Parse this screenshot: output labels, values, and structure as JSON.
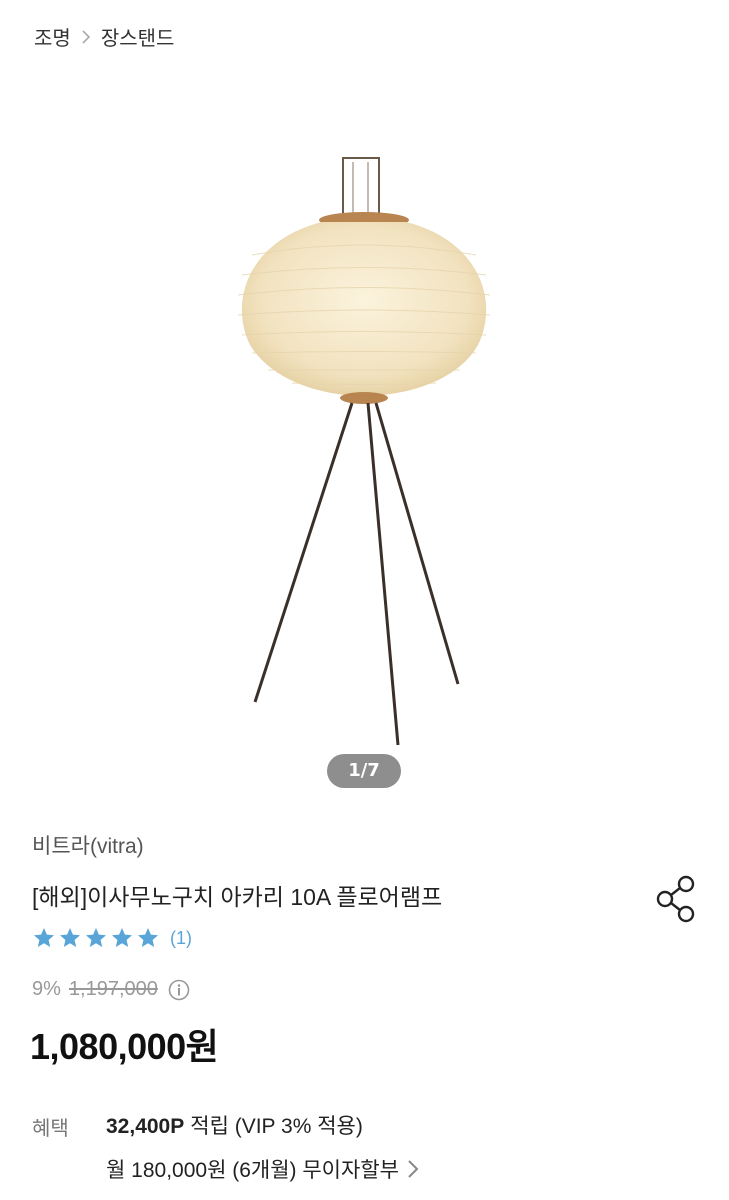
{
  "breadcrumb": {
    "items": [
      "조명",
      "장스탠드"
    ]
  },
  "gallery": {
    "counter": "1/7"
  },
  "product": {
    "brand": "비트라(vitra)",
    "title": "[해외]이사무노구치 아카리 10A 플로어램프",
    "rating_stars": 5,
    "review_count": "(1)",
    "discount_rate": "9%",
    "original_price": "1,197,000",
    "price": "1,080,000원"
  },
  "benefits": {
    "label": "혜택",
    "points": "32,400P",
    "points_suffix": "적립 (VIP 3% 적용)",
    "installment": "월 180,000원 (6개월) 무이자할부"
  },
  "colors": {
    "star": "#5aa5d8",
    "pager_bg": "#8e8e8e"
  }
}
